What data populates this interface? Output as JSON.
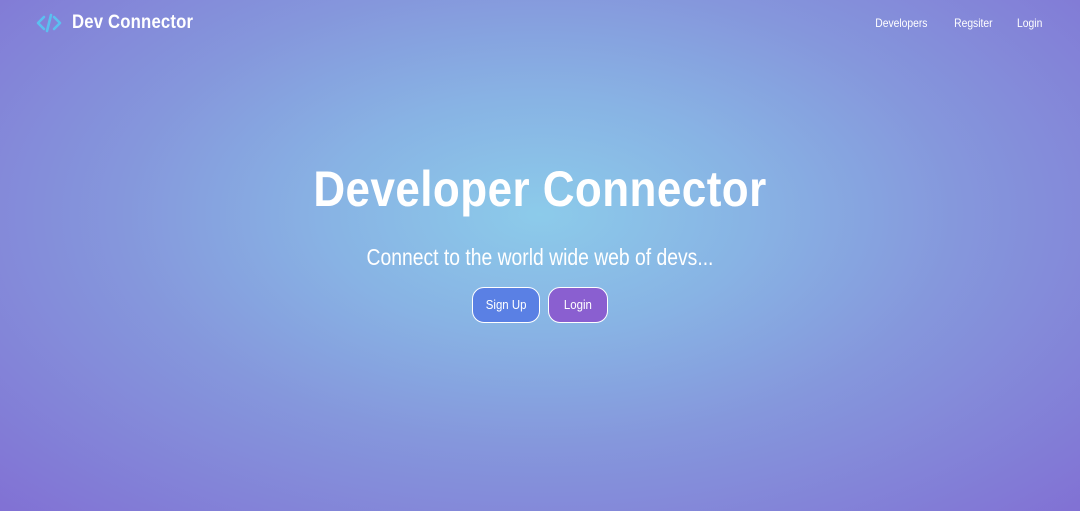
{
  "navbar": {
    "brand_label": "Dev Connector",
    "brand_icon": "code-icon",
    "links": [
      {
        "label": "Developers"
      },
      {
        "label": "Regsiter"
      },
      {
        "label": "Login"
      }
    ]
  },
  "hero": {
    "title": "Developer Connector",
    "lead": "Connect to the world wide web of devs...",
    "signup_label": "Sign Up",
    "login_label": "Login"
  },
  "colors": {
    "accent_icon": "#5bc0f0",
    "signup_button": "#5a80e4",
    "login_button": "#8a5fd0",
    "background_center": "#8ccbea",
    "background_edge": "#8171d4"
  }
}
